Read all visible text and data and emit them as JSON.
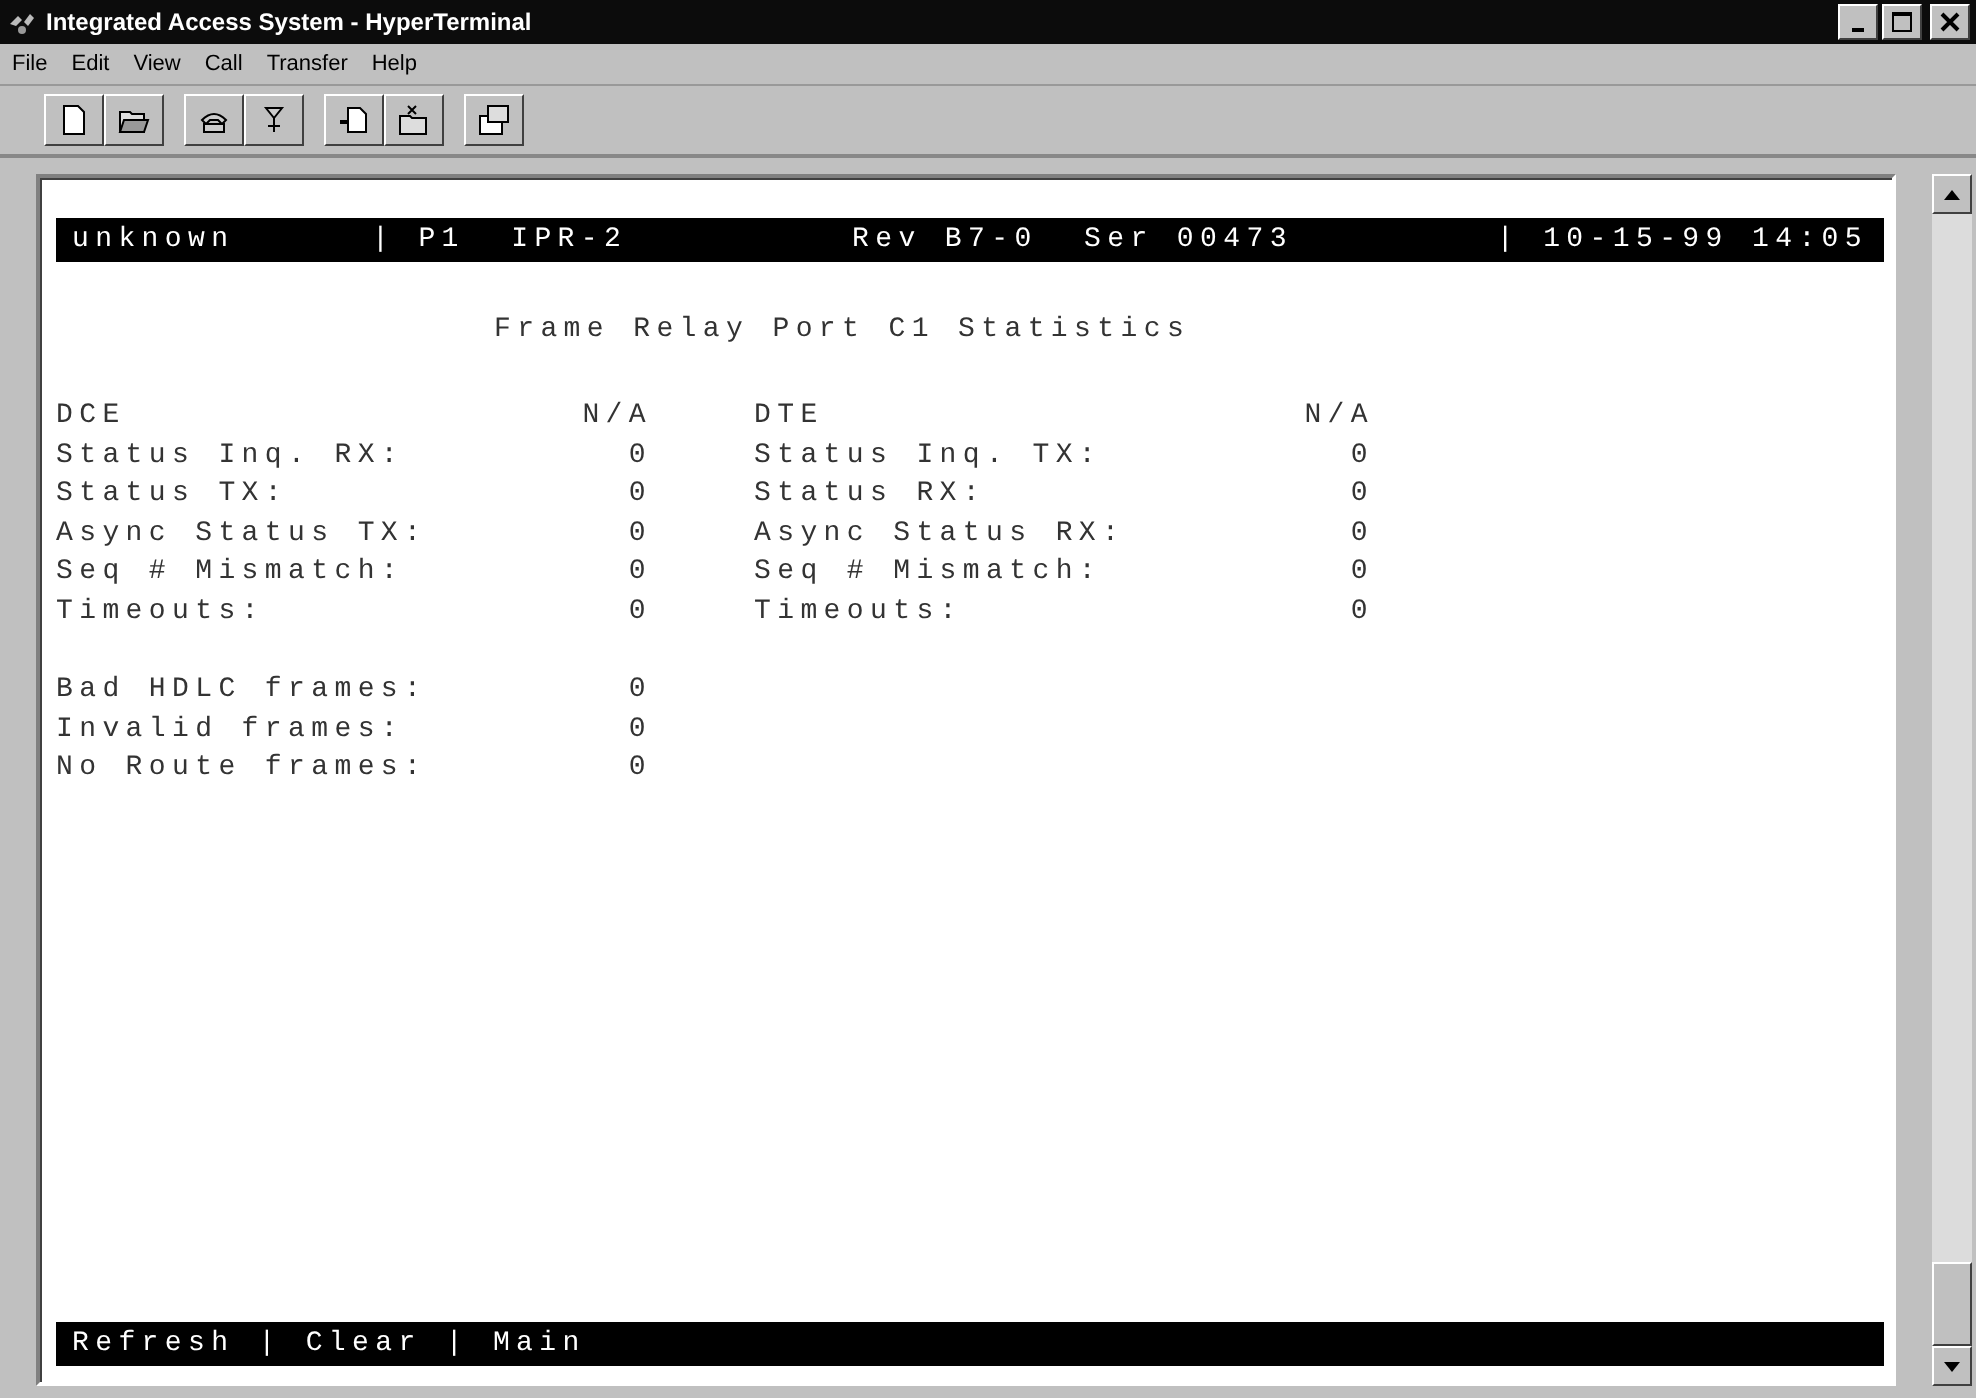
{
  "window": {
    "title": "Integrated Access System - HyperTerminal"
  },
  "menu": [
    {
      "label": "File"
    },
    {
      "label": "Edit"
    },
    {
      "label": "View"
    },
    {
      "label": "Call"
    },
    {
      "label": "Transfer"
    },
    {
      "label": "Help"
    }
  ],
  "terminal": {
    "header": [
      "unknown",
      "| P1  IPR-2",
      "Rev B7-0  Ser 00473",
      "| 10-15-99 14:05"
    ],
    "title": "Frame Relay Port C1 Statistics",
    "left": {
      "heading": "DCE",
      "value": "N/A",
      "rows": [
        {
          "label": "Status Inq. RX:",
          "value": "0"
        },
        {
          "label": "Status TX:",
          "value": "0"
        },
        {
          "label": "Async Status TX:",
          "value": "0"
        },
        {
          "label": "Seq # Mismatch:",
          "value": "0"
        },
        {
          "label": "Timeouts:",
          "value": "0"
        }
      ]
    },
    "right": {
      "heading": "DTE",
      "value": "N/A",
      "rows": [
        {
          "label": "Status Inq. TX:",
          "value": "0"
        },
        {
          "label": "Status RX:",
          "value": "0"
        },
        {
          "label": "Async Status RX:",
          "value": "0"
        },
        {
          "label": "Seq # Mismatch:",
          "value": "0"
        },
        {
          "label": "Timeouts:",
          "value": "0"
        }
      ]
    },
    "frames": [
      {
        "label": "Bad HDLC frames:",
        "value": "0"
      },
      {
        "label": "Invalid frames:",
        "value": "0"
      },
      {
        "label": "No Route frames:",
        "value": "0"
      }
    ],
    "commands": {
      "separator": "|",
      "items": [
        "Refresh",
        "Clear",
        "Main"
      ]
    }
  }
}
